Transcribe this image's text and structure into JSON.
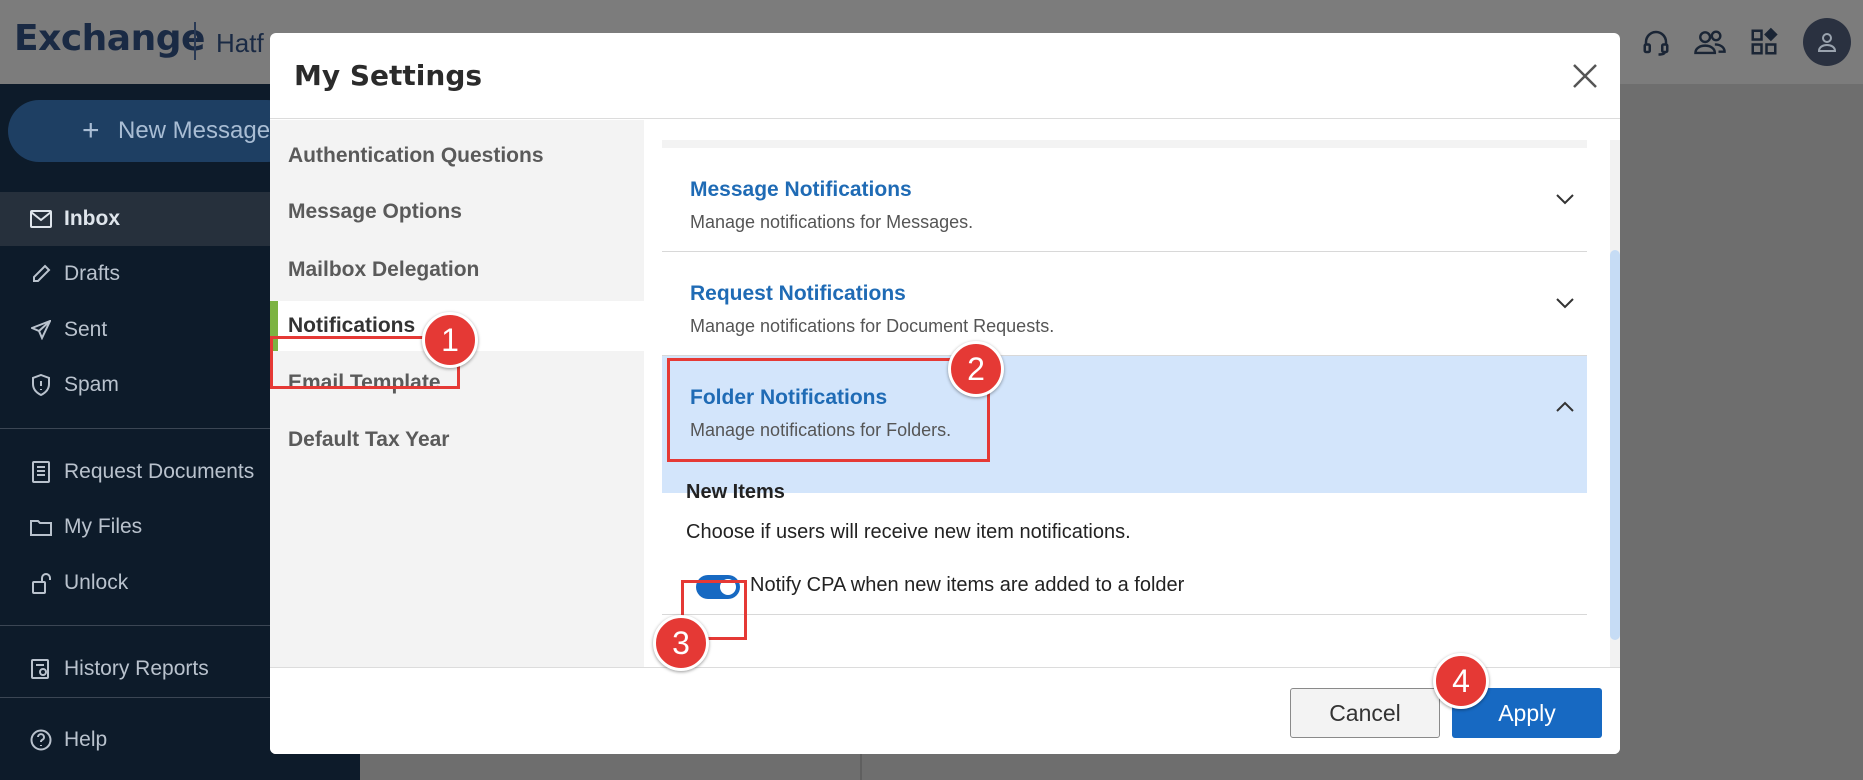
{
  "app": {
    "brand": "Exchange",
    "org_fragment": "Hatf"
  },
  "sidebar": {
    "new_message_label": "New Message",
    "items": [
      {
        "label": "Inbox",
        "icon": "mail-icon",
        "active": true
      },
      {
        "label": "Drafts",
        "icon": "pencil-icon"
      },
      {
        "label": "Sent",
        "icon": "send-icon"
      },
      {
        "label": "Spam",
        "icon": "shield-icon"
      },
      {
        "label": "Request Documents",
        "icon": "document-icon"
      },
      {
        "label": "My Files",
        "icon": "folder-icon"
      },
      {
        "label": "Unlock",
        "icon": "unlock-icon"
      },
      {
        "label": "History Reports",
        "icon": "report-icon"
      },
      {
        "label": "Help",
        "icon": "help-icon"
      }
    ]
  },
  "topbar_icons": [
    "headset-icon",
    "users-icon",
    "apps-icon",
    "user-avatar-icon"
  ],
  "modal": {
    "title": "My Settings",
    "nav": [
      {
        "label": "Authentication Questions"
      },
      {
        "label": "Message Options"
      },
      {
        "label": "Mailbox Delegation"
      },
      {
        "label": "Notifications",
        "active": true
      },
      {
        "label": "Email Template"
      },
      {
        "label": "Default Tax Year"
      }
    ],
    "sections": [
      {
        "title": "Message Notifications",
        "subtitle": "Manage notifications for Messages.",
        "expanded": false
      },
      {
        "title": "Request Notifications",
        "subtitle": "Manage notifications for Document Requests.",
        "expanded": false
      },
      {
        "title": "Folder Notifications",
        "subtitle": "Manage notifications for Folders.",
        "expanded": true
      }
    ],
    "folder_body": {
      "heading": "New Items",
      "description": "Choose if users will receive new item notifications.",
      "toggle_label": "Notify CPA when new items are added to a folder",
      "toggle_on": true
    },
    "footer": {
      "cancel_label": "Cancel",
      "apply_label": "Apply"
    }
  },
  "annotations": {
    "steps": [
      "1",
      "2",
      "3",
      "4"
    ],
    "color": "#e53935"
  },
  "colors": {
    "accent": "#1769c2",
    "link": "#1f6bb5",
    "active_nav_marker": "#7cb342",
    "expanded_section_bg": "#d3e5fb"
  }
}
